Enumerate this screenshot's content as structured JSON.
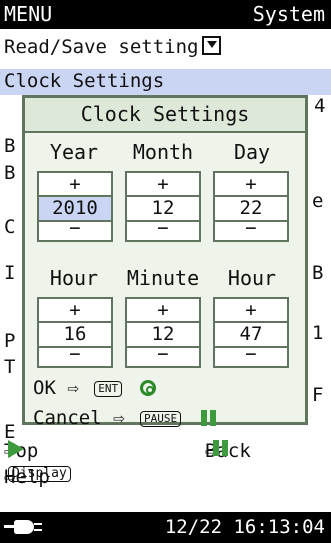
{
  "titlebar": {
    "left": "MENU",
    "right": "System"
  },
  "menu": {
    "read_save": "Read/Save setting",
    "clock": "Clock Settings",
    "partials": {
      "b1": "B",
      "b2": "B",
      "c": "C",
      "i": "I",
      "p": "P",
      "t": "T",
      "e": "E"
    },
    "right_partials": {
      "r1": "4",
      "r2": "e",
      "r3": "B",
      "r4": "1",
      "r5": "F"
    },
    "top": "Top",
    "back": "Back",
    "help": "Help",
    "display_key": "Display"
  },
  "dialog": {
    "title": "Clock Settings",
    "date_headers": [
      "Year",
      "Month",
      "Day"
    ],
    "date_values": [
      "2010",
      "12",
      "22"
    ],
    "time_headers": [
      "Hour",
      "Minute",
      "Hour"
    ],
    "time_values": [
      "16",
      "12",
      "47"
    ],
    "plus": "+",
    "minus": "−",
    "ok": "OK",
    "ent_key": "ENT",
    "cancel": "Cancel",
    "pause_key": "PAUSE"
  },
  "footer": {
    "datetime": "12/22 16:13:04"
  },
  "colors": {
    "highlight": "#c9d5f3",
    "dialog_border": "#60745e",
    "green": "#3d9b3d"
  }
}
